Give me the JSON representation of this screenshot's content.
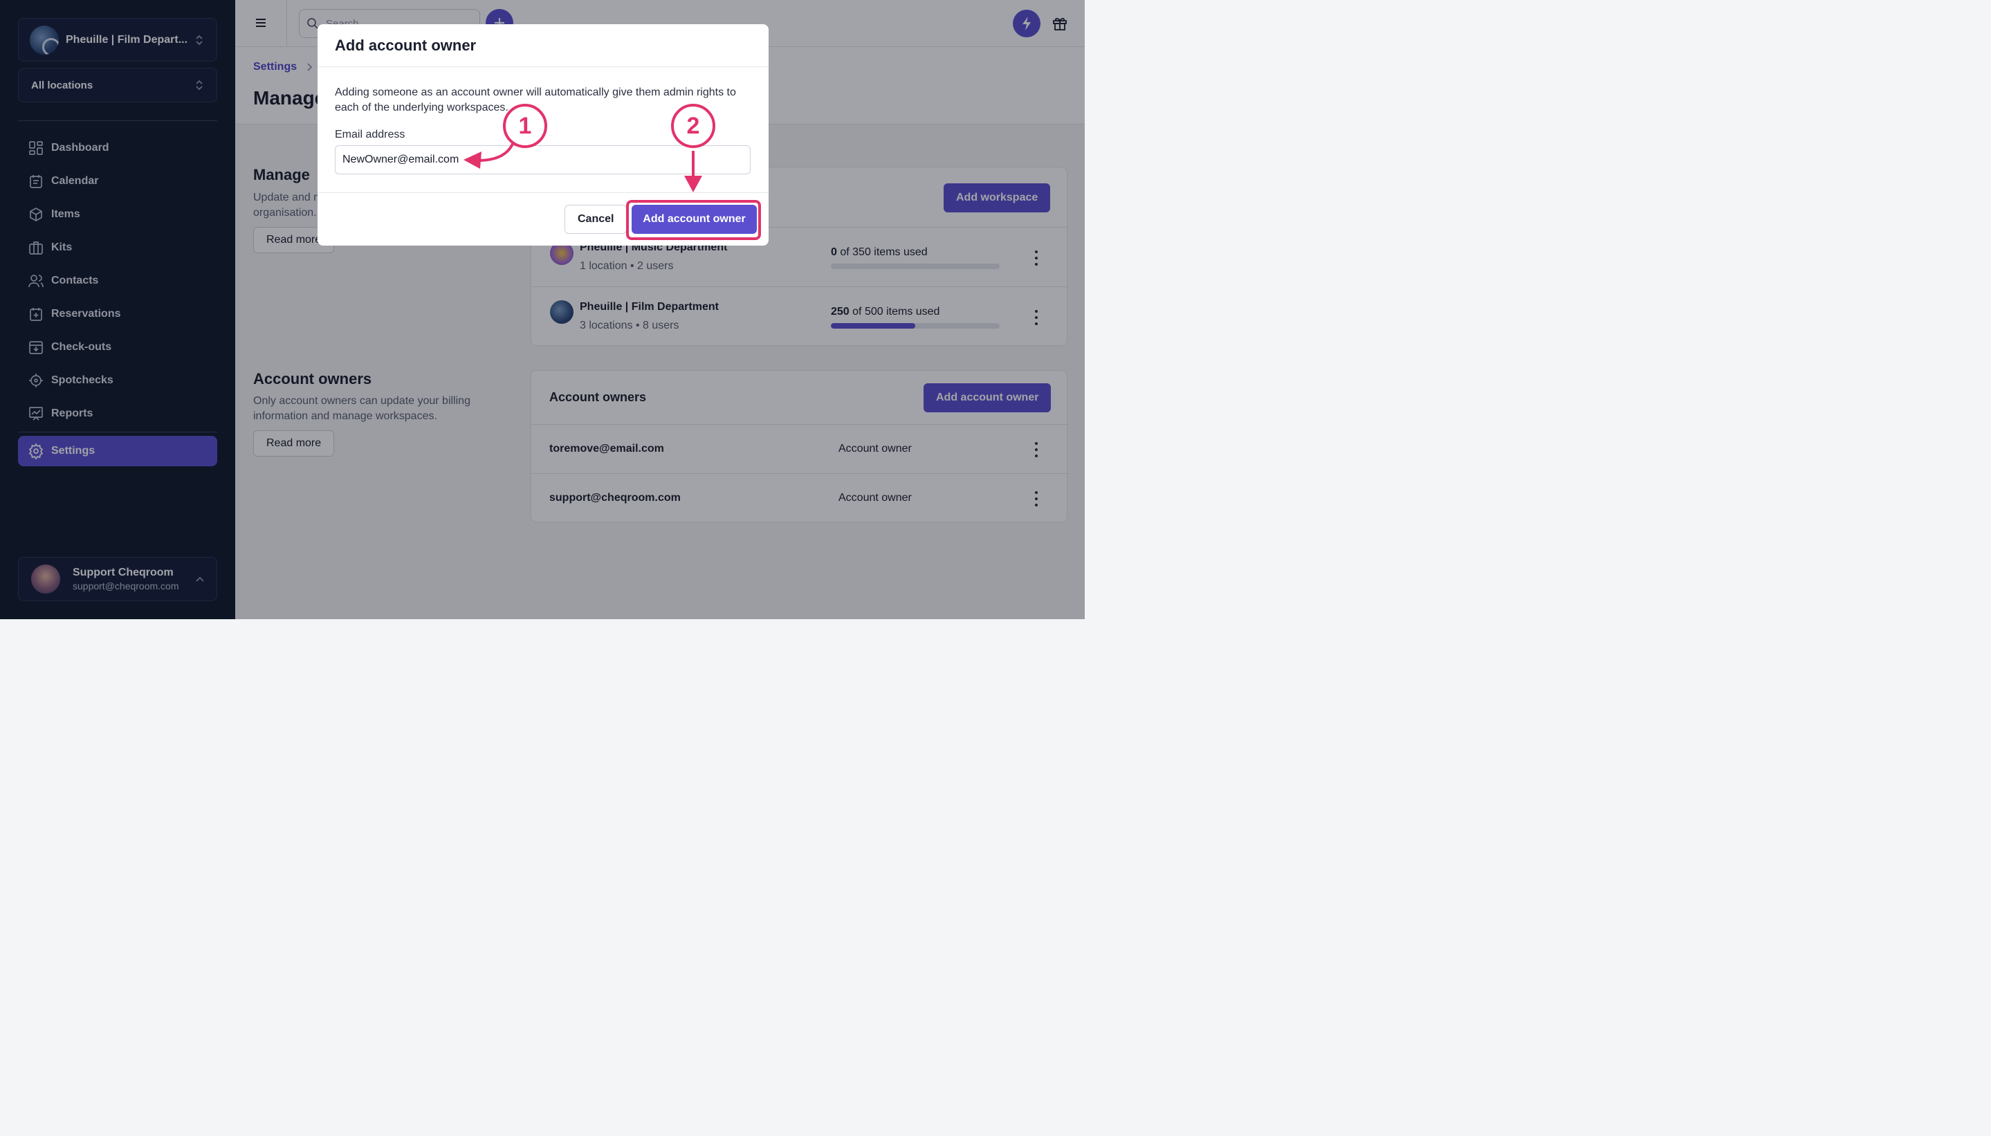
{
  "sidebar": {
    "org_name": "Pheuille | Film Depart...",
    "location_selector": "All locations",
    "items": [
      {
        "label": "Dashboard",
        "icon": "dashboard-icon"
      },
      {
        "label": "Calendar",
        "icon": "calendar-icon"
      },
      {
        "label": "Items",
        "icon": "box-icon"
      },
      {
        "label": "Kits",
        "icon": "briefcase-icon"
      },
      {
        "label": "Contacts",
        "icon": "users-icon"
      },
      {
        "label": "Reservations",
        "icon": "calendar-plus-icon"
      },
      {
        "label": "Check-outs",
        "icon": "inbox-download-icon"
      },
      {
        "label": "Spotchecks",
        "icon": "crosshair-icon"
      },
      {
        "label": "Reports",
        "icon": "chart-board-icon"
      }
    ],
    "settings_label": "Settings",
    "user": {
      "name": "Support Cheqroom",
      "email": "support@cheqroom.com"
    }
  },
  "topbar": {
    "search_placeholder": "Search"
  },
  "page": {
    "breadcrumb": "Settings",
    "title": "Manage",
    "workspaces_section": {
      "title": "Manage",
      "description": "Update and manage the workspaces of your organisation.",
      "read_more": "Read more",
      "add_button": "Add workspace"
    },
    "workspaces": [
      {
        "name": "Pheuille | Music Department",
        "locations": "1 location",
        "users": "2 users",
        "used": "0",
        "limit_text": "of 350 items used",
        "fraction": 0.0
      },
      {
        "name": "Pheuille | Film Department",
        "locations": "3 locations",
        "users": "8 users",
        "used": "250",
        "limit_text": "of 500 items used",
        "fraction": 0.5
      }
    ],
    "owners_section": {
      "title": "Account owners",
      "description": "Only account owners can update your billing information and manage workspaces.",
      "read_more": "Read more",
      "card_title": "Account owners",
      "add_button": "Add account owner"
    },
    "owners": [
      {
        "email": "toremove@email.com",
        "role": "Account owner"
      },
      {
        "email": "support@cheqroom.com",
        "role": "Account owner"
      }
    ]
  },
  "modal": {
    "title": "Add account owner",
    "text": "Adding someone as an account owner will automatically give them admin rights to each of the underlying workspaces.",
    "email_label": "Email address",
    "email_value": "NewOwner@email.com",
    "cancel": "Cancel",
    "confirm": "Add account owner"
  },
  "annotations": {
    "step1": "1",
    "step2": "2",
    "color": "#e2336b"
  },
  "colors": {
    "accent": "#5b4fd0",
    "sidebar_bg": "#111a2d"
  }
}
